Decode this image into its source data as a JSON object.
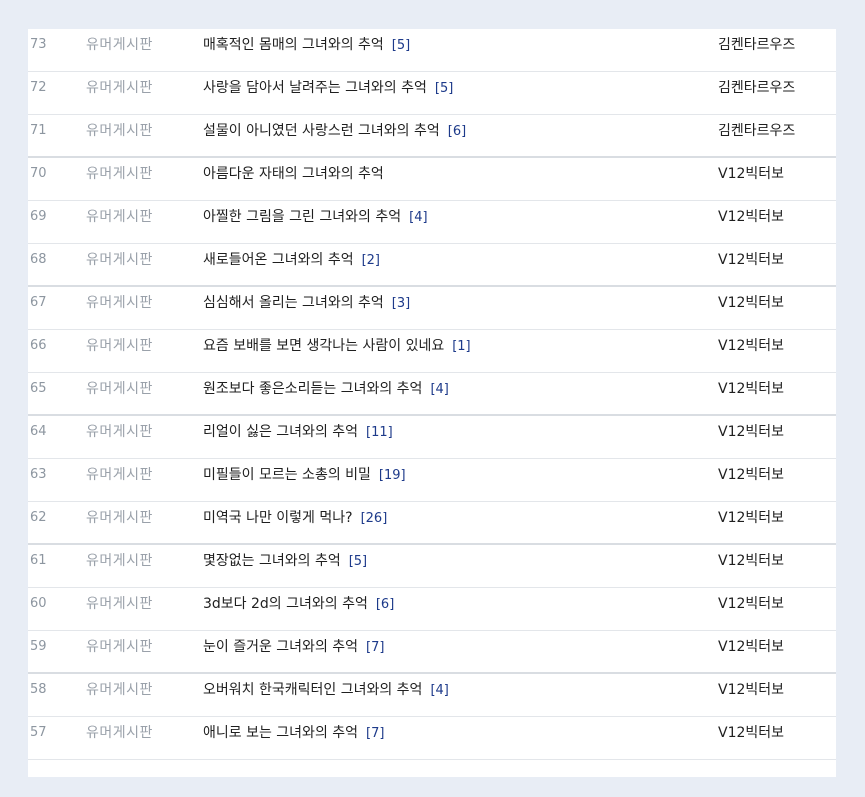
{
  "board_name": "유머게시판",
  "posts": [
    {
      "num": "73",
      "board": "유머게시판",
      "title": "매혹적인 몸매의 그녀와의 추억",
      "comments": "[5]",
      "author": "김켄타르우즈"
    },
    {
      "num": "72",
      "board": "유머게시판",
      "title": "사랑을 담아서 날려주는 그녀와의 추억",
      "comments": "[5]",
      "author": "김켄타르우즈"
    },
    {
      "num": "71",
      "board": "유머게시판",
      "title": "설물이 아니였던 사랑스런 그녀와의 추억",
      "comments": "[6]",
      "author": "김켄타르우즈"
    },
    {
      "num": "70",
      "board": "유머게시판",
      "title": "아름다운 자태의 그녀와의 추억",
      "comments": "",
      "author": "V12빅터보"
    },
    {
      "num": "69",
      "board": "유머게시판",
      "title": "아찔한 그림을 그린 그녀와의 추억",
      "comments": "[4]",
      "author": "V12빅터보"
    },
    {
      "num": "68",
      "board": "유머게시판",
      "title": "새로들어온 그녀와의 추억",
      "comments": "[2]",
      "author": "V12빅터보"
    },
    {
      "num": "67",
      "board": "유머게시판",
      "title": "심심해서 올리는 그녀와의 추억",
      "comments": "[3]",
      "author": "V12빅터보"
    },
    {
      "num": "66",
      "board": "유머게시판",
      "title": "요즘 보배를 보면 생각나는 사람이 있네요",
      "comments": "[1]",
      "author": "V12빅터보"
    },
    {
      "num": "65",
      "board": "유머게시판",
      "title": "원조보다 좋은소리듣는 그녀와의 추억",
      "comments": "[4]",
      "author": "V12빅터보"
    },
    {
      "num": "64",
      "board": "유머게시판",
      "title": "리얼이 싫은 그녀와의 추억",
      "comments": "[11]",
      "author": "V12빅터보"
    },
    {
      "num": "63",
      "board": "유머게시판",
      "title": "미필들이 모르는 소총의 비밀",
      "comments": "[19]",
      "author": "V12빅터보"
    },
    {
      "num": "62",
      "board": "유머게시판",
      "title": "미역국 나만 이렇게 먹나?",
      "comments": "[26]",
      "author": "V12빅터보"
    },
    {
      "num": "61",
      "board": "유머게시판",
      "title": "몇장없는 그녀와의 추억",
      "comments": "[5]",
      "author": "V12빅터보"
    },
    {
      "num": "60",
      "board": "유머게시판",
      "title": "3d보다 2d의 그녀와의 추억",
      "comments": "[6]",
      "author": "V12빅터보"
    },
    {
      "num": "59",
      "board": "유머게시판",
      "title": "눈이 즐거운 그녀와의 추억",
      "comments": "[7]",
      "author": "V12빅터보"
    },
    {
      "num": "58",
      "board": "유머게시판",
      "title": "오버워치 한국캐릭터인 그녀와의 추억",
      "comments": "[4]",
      "author": "V12빅터보"
    },
    {
      "num": "57",
      "board": "유머게시판",
      "title": "애니로 보는 그녀와의 추억",
      "comments": "[7]",
      "author": "V12빅터보"
    }
  ]
}
